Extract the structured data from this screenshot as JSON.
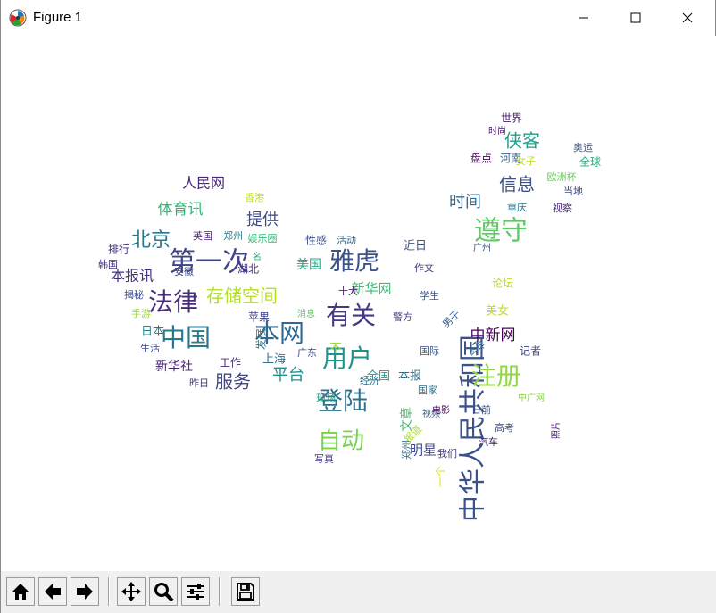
{
  "window": {
    "title": "Figure 1",
    "controls": [
      "minimize",
      "maximize",
      "close"
    ]
  },
  "colors": {
    "palette": "viridis",
    "toolbar_bg": "#f0f0f0",
    "title_bg": "#ffffff"
  },
  "toolbar": {
    "buttons": [
      {
        "name": "home-button",
        "icon": "home-icon"
      },
      {
        "name": "back-button",
        "icon": "arrow-left-icon"
      },
      {
        "name": "forward-button",
        "icon": "arrow-right-icon"
      },
      {
        "name": "pan-button",
        "icon": "move-arrows-icon"
      },
      {
        "name": "zoom-button",
        "icon": "magnifier-icon"
      },
      {
        "name": "configure-subplots-button",
        "icon": "sliders-icon"
      },
      {
        "name": "save-button",
        "icon": "floppy-disk-icon"
      }
    ]
  },
  "wordcloud": {
    "words": [
      {
        "text": "中华人民共和国",
        "color": "#3b528b"
      },
      {
        "text": "第一次",
        "color": "#414487"
      },
      {
        "text": "本网",
        "color": "#31688e"
      },
      {
        "text": "中国",
        "color": "#2a788e"
      },
      {
        "text": "法律",
        "color": "#472d7b"
      },
      {
        "text": "雅虎",
        "color": "#3b528b"
      },
      {
        "text": "有关",
        "color": "#443983"
      },
      {
        "text": "用户",
        "color": "#21918c"
      },
      {
        "text": "登陆",
        "color": "#2c728e"
      },
      {
        "text": "注册",
        "color": "#90d743"
      },
      {
        "text": "遵守",
        "color": "#5ec962"
      },
      {
        "text": "自动",
        "color": "#7ad151"
      },
      {
        "text": "存储空间",
        "color": "#b5de2b"
      },
      {
        "text": "北京",
        "color": "#2a788e"
      },
      {
        "text": "提供",
        "color": "#3e4a89"
      },
      {
        "text": "服务",
        "color": "#414487"
      },
      {
        "text": "平台",
        "color": "#21918c"
      },
      {
        "text": "信息",
        "color": "#3b528b"
      },
      {
        "text": "侠客",
        "color": "#1f9e89"
      },
      {
        "text": "时间",
        "color": "#31688e"
      },
      {
        "text": "体育讯",
        "color": "#35b779"
      },
      {
        "text": "人民网",
        "color": "#482878"
      },
      {
        "text": "本报讯",
        "color": "#46327e"
      },
      {
        "text": "新华网",
        "color": "#3fbc73"
      },
      {
        "text": "中新网",
        "color": "#440154"
      },
      {
        "text": "美国",
        "color": "#22a884"
      },
      {
        "text": "新华社",
        "color": "#482475"
      },
      {
        "text": "全国",
        "color": "#1f9a8a"
      },
      {
        "text": "本报",
        "color": "#2d708e"
      },
      {
        "text": "明星",
        "color": "#3e4989"
      },
      {
        "text": "文章",
        "color": "#4ac16d"
      },
      {
        "text": "美女",
        "color": "#bddf26"
      },
      {
        "text": "世界",
        "color": "#481a6c"
      },
      {
        "text": "时尚",
        "color": "#48186a"
      },
      {
        "text": "盘点",
        "color": "#440154"
      },
      {
        "text": "河南",
        "color": "#355f8d"
      },
      {
        "text": "女子",
        "color": "#c2df23"
      },
      {
        "text": "奥运",
        "color": "#39568c"
      },
      {
        "text": "全球",
        "color": "#25ac82"
      },
      {
        "text": "欧洲杯",
        "color": "#6ccd5a"
      },
      {
        "text": "当地",
        "color": "#3f4889"
      },
      {
        "text": "视察",
        "color": "#482979"
      },
      {
        "text": "重庆",
        "color": "#287c8e"
      },
      {
        "text": "广州",
        "color": "#3c4f8a"
      },
      {
        "text": "近日",
        "color": "#3b528b"
      },
      {
        "text": "作文",
        "color": "#46337f"
      },
      {
        "text": "论坛",
        "color": "#b8de29"
      },
      {
        "text": "记者",
        "color": "#414487"
      },
      {
        "text": "今年",
        "color": "#2d708e"
      },
      {
        "text": "日前",
        "color": "#3e4a89"
      },
      {
        "text": "中广网",
        "color": "#8fd744"
      },
      {
        "text": "高考",
        "color": "#3a548c"
      },
      {
        "text": "汽车",
        "color": "#481f70"
      },
      {
        "text": "照片",
        "color": "#482173"
      },
      {
        "text": "我们",
        "color": "#46327e"
      },
      {
        "text": "一个",
        "color": "#d8e219"
      },
      {
        "text": "视频",
        "color": "#355e8d"
      },
      {
        "text": "写真",
        "color": "#443a83"
      },
      {
        "text": "郑州",
        "color": "#2e6e8e"
      },
      {
        "text": "现场",
        "color": "#1fa187"
      },
      {
        "text": "经济",
        "color": "#2c728e"
      },
      {
        "text": "国际",
        "color": "#39558c"
      },
      {
        "text": "国家",
        "color": "#2b758e"
      },
      {
        "text": "电影",
        "color": "#440154"
      },
      {
        "text": "报道",
        "color": "#addc30"
      },
      {
        "text": "上海",
        "color": "#2e6e8e"
      },
      {
        "text": "广东",
        "color": "#3e4a89"
      },
      {
        "text": "工作",
        "color": "#482576"
      },
      {
        "text": "昨日",
        "color": "#463480"
      },
      {
        "text": "生活",
        "color": "#404688"
      },
      {
        "text": "日本",
        "color": "#26828e"
      },
      {
        "text": "手游",
        "color": "#a0da39"
      },
      {
        "text": "揭秘",
        "color": "#3e4c8a"
      },
      {
        "text": "韩国",
        "color": "#46307e"
      },
      {
        "text": "排行",
        "color": "#472d7b"
      },
      {
        "text": "英国",
        "color": "#481f70"
      },
      {
        "text": "郑州",
        "color": "#26828e"
      },
      {
        "text": "香港",
        "color": "#c8e020"
      },
      {
        "text": "娱乐圈",
        "color": "#35b779"
      },
      {
        "text": "性感",
        "color": "#3b528b"
      },
      {
        "text": "活动",
        "color": "#31688e"
      },
      {
        "text": "十大",
        "color": "#482878"
      },
      {
        "text": "苹果",
        "color": "#414487"
      },
      {
        "text": "消息",
        "color": "#5ec962"
      },
      {
        "text": "警方",
        "color": "#433e85"
      },
      {
        "text": "学生",
        "color": "#3b528b"
      },
      {
        "text": "男子",
        "color": "#365d8d"
      },
      {
        "text": "发展",
        "color": "#2a788e"
      },
      {
        "text": "不",
        "color": "#9fda3a"
      },
      {
        "text": "名",
        "color": "#25ac82"
      },
      {
        "text": "安徽",
        "color": "#3e4a89"
      },
      {
        "text": "湖北",
        "color": "#46307e"
      }
    ]
  }
}
